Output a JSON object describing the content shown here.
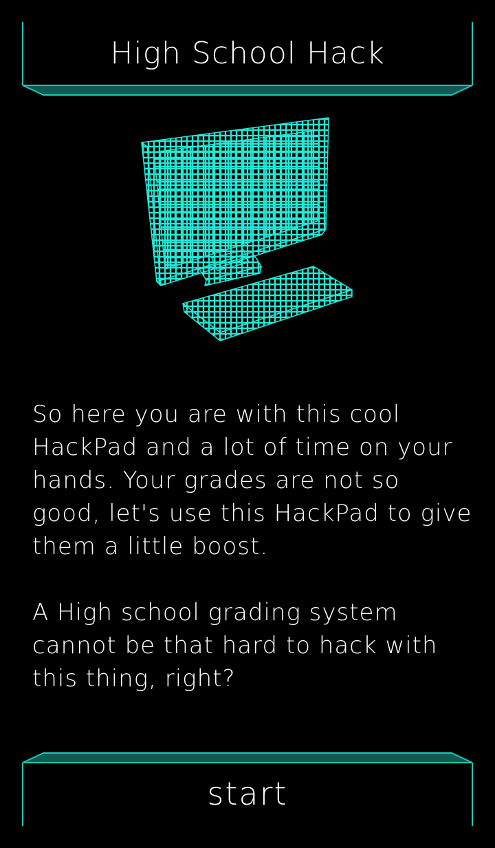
{
  "header": {
    "title": "High School Hack"
  },
  "illustration": {
    "icon": "computer-icon",
    "color": "#22e8d6"
  },
  "story": {
    "paragraphs": [
      "So here you are with this cool HackPad and a lot of time on your hands. Your grades are not so good, let's use this HackPad to give them a little boost.",
      "A High school grading system cannot be that hard to hack with this thing, right?"
    ]
  },
  "actions": {
    "start_label": "start"
  },
  "colors": {
    "accent": "#1ec9b3",
    "accent_fill": "#0f5a52",
    "background": "#000000",
    "text": "#ffffff"
  }
}
